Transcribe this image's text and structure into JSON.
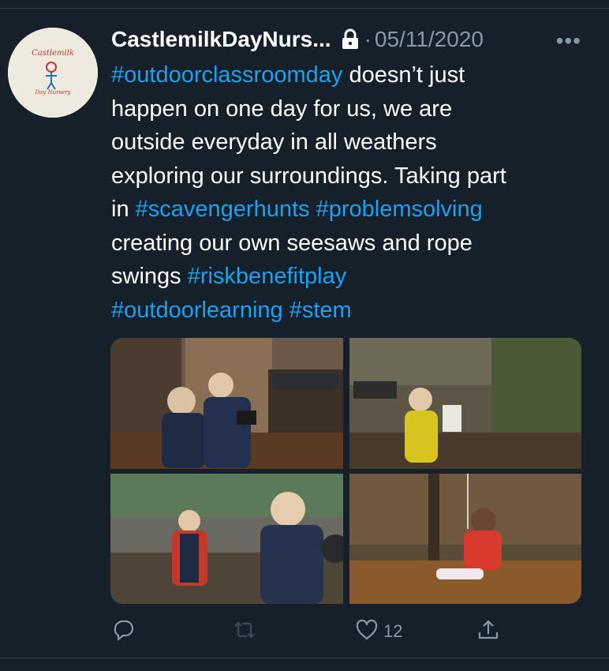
{
  "tweet": {
    "author_name": "CastlemilkDayNurs...",
    "separator": "·",
    "date": "05/11/2020",
    "more_label": "•••",
    "avatar_text_top": "Castlemilk",
    "avatar_text_bottom": "Day Nursery",
    "lines": [
      [
        {
          "t": "#outdoorclassroomday",
          "tag": true
        },
        {
          "t": " doesn’t just",
          "tag": false
        }
      ],
      [
        {
          "t": "happen on one day for us, we are",
          "tag": false
        }
      ],
      [
        {
          "t": "outside everyday in all weathers",
          "tag": false
        }
      ],
      [
        {
          "t": "exploring our surroundings. Taking part",
          "tag": false
        }
      ],
      [
        {
          "t": "in ",
          "tag": false
        },
        {
          "t": "#scavengerhunts",
          "tag": true
        },
        {
          "t": " ",
          "tag": false
        },
        {
          "t": "#problemsolving",
          "tag": true
        }
      ],
      [
        {
          "t": "creating our own seesaws and rope",
          "tag": false
        }
      ],
      [
        {
          "t": "swings ",
          "tag": false
        },
        {
          "t": "#riskbenefitplay",
          "tag": true
        }
      ],
      [
        {
          "t": "#outdoorlearning",
          "tag": true
        },
        {
          "t": " ",
          "tag": false
        },
        {
          "t": "#stem",
          "tag": true
        }
      ]
    ],
    "actions": {
      "reply_count": "",
      "retweet_count": "",
      "like_count": "12",
      "share_count": ""
    }
  },
  "colors": {
    "background": "#15202b",
    "text": "#ffffff",
    "secondary": "#8899a6",
    "hashtag": "#1da1f2"
  }
}
